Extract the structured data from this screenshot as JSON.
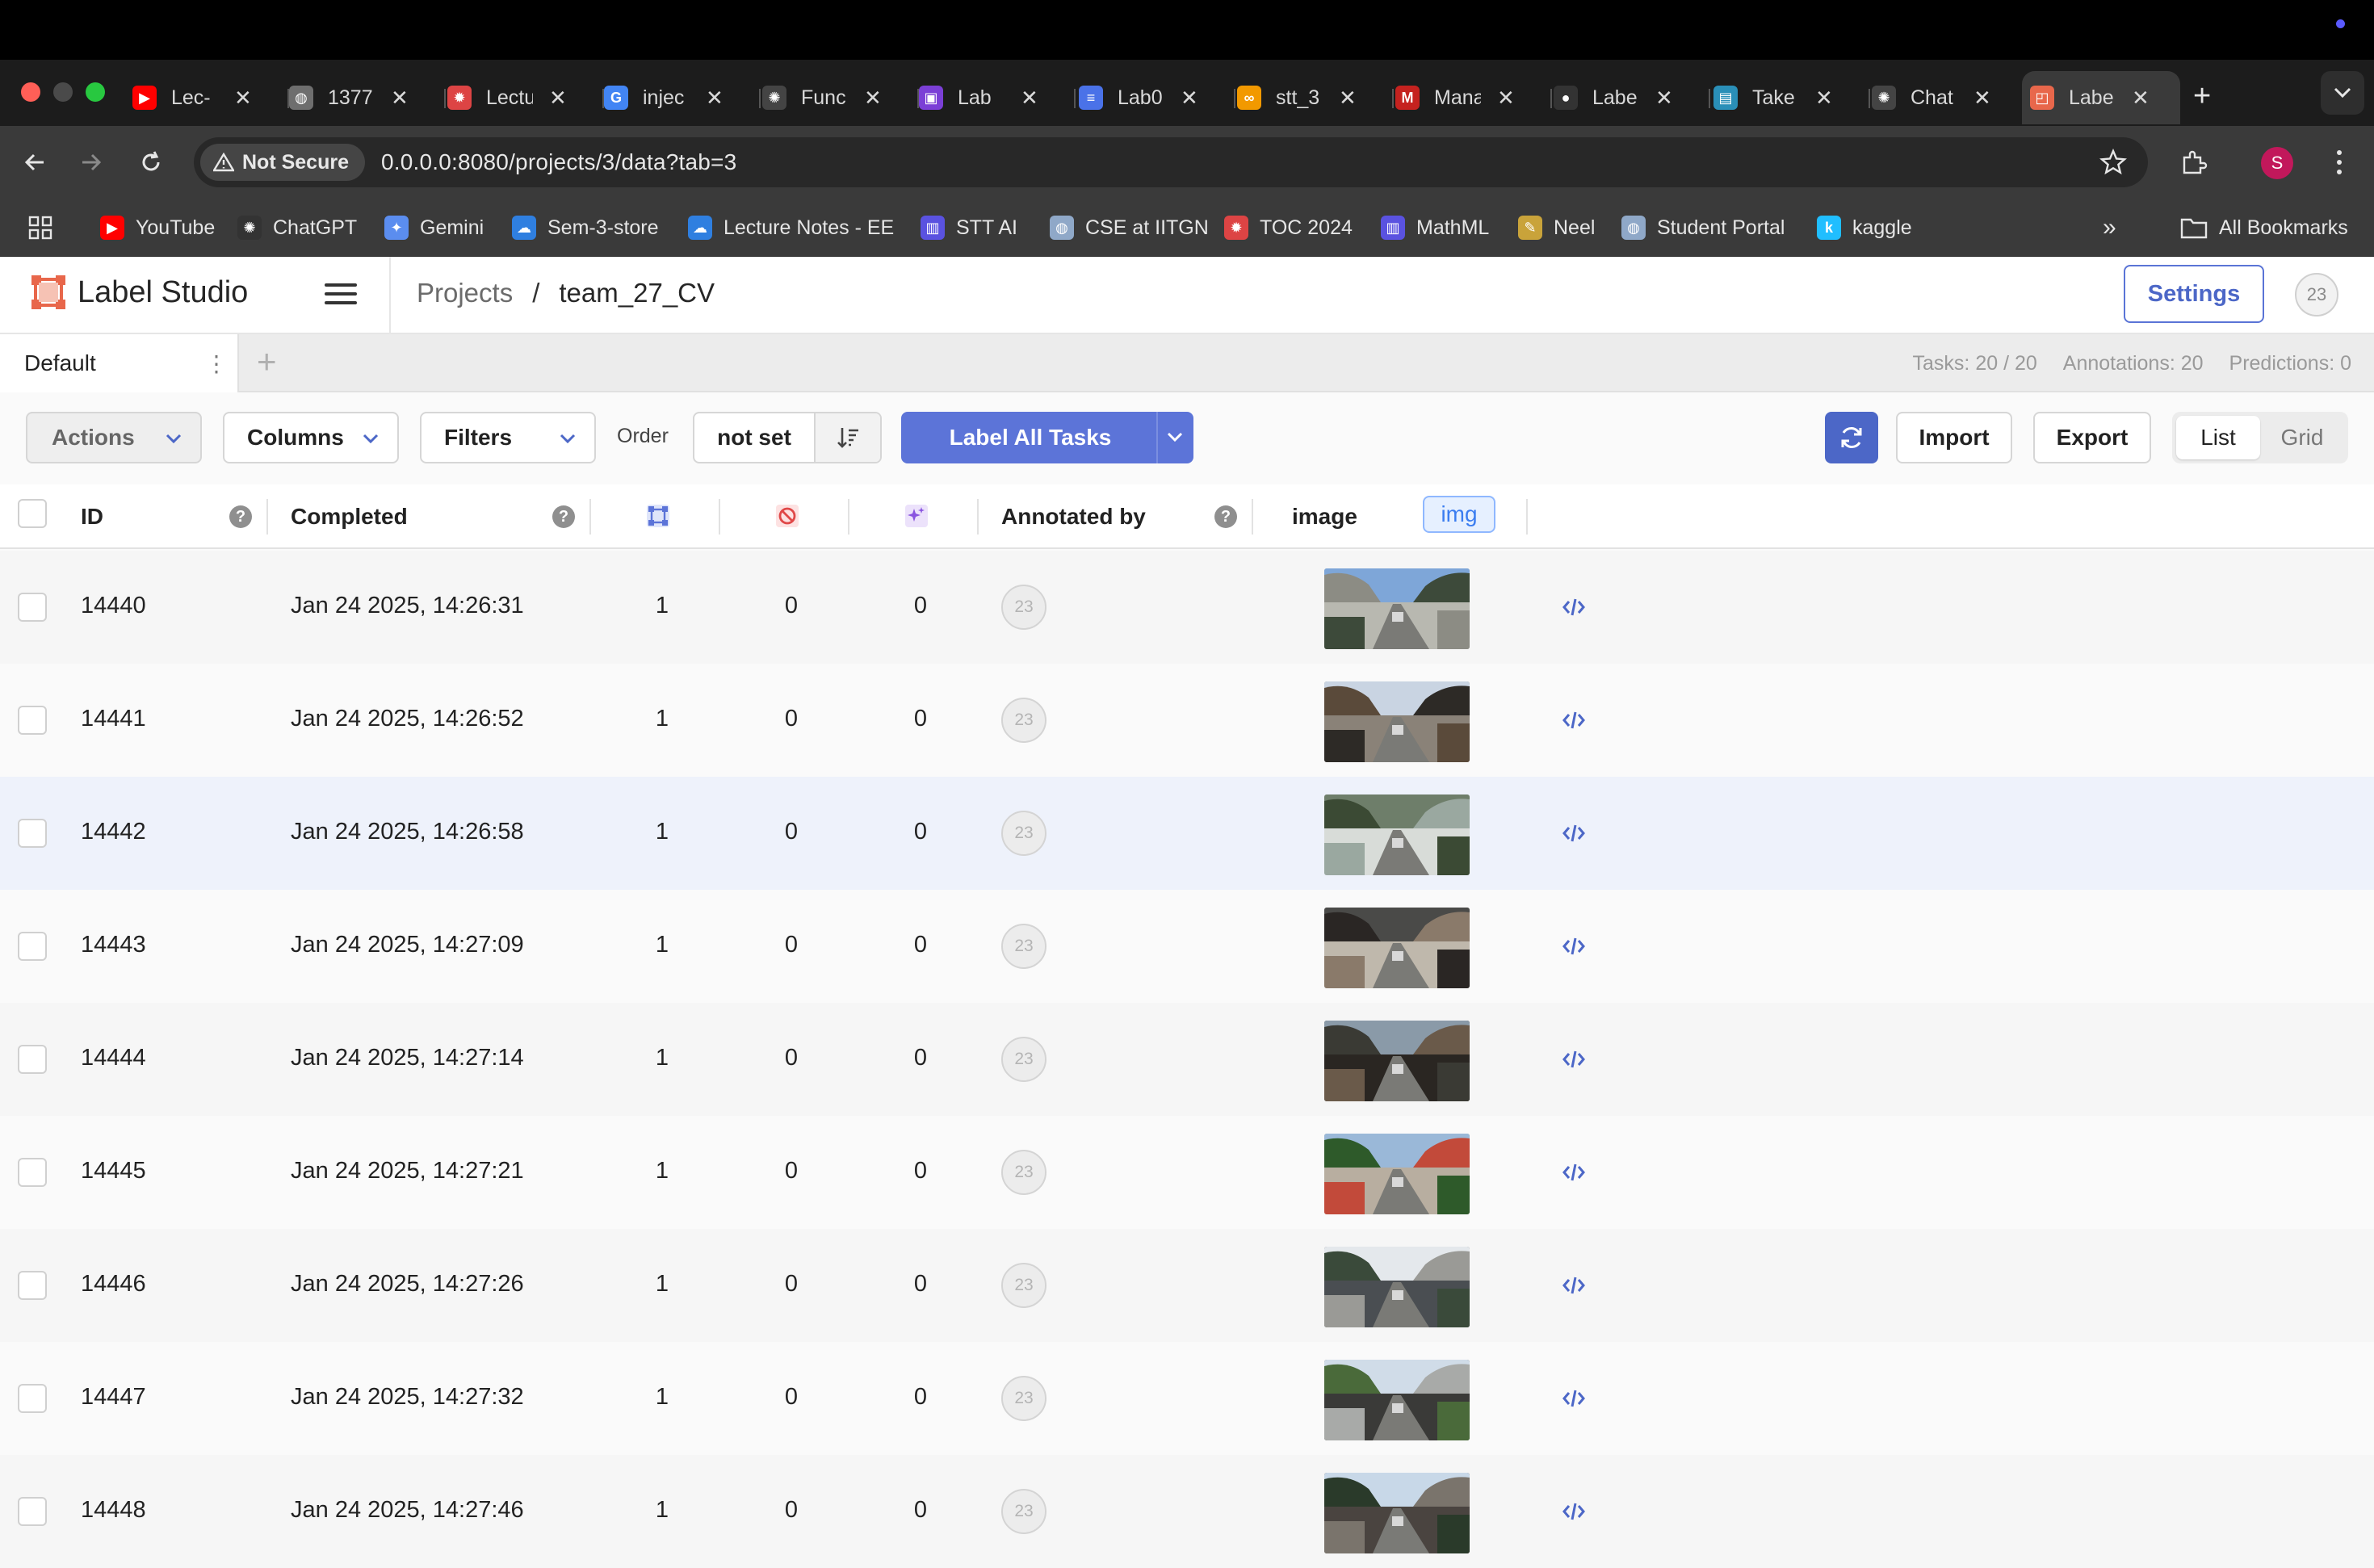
{
  "browser": {
    "tabs": [
      {
        "label": "Lec-",
        "icon": "youtube-icon",
        "color": "#ff0000",
        "glyph": "▶"
      },
      {
        "label": "1377",
        "icon": "globe-icon",
        "color": "#6e6e6e",
        "glyph": "◍"
      },
      {
        "label": "Lectu",
        "icon": "gear-red-icon",
        "color": "#d44",
        "glyph": "✹"
      },
      {
        "label": "injec",
        "icon": "google-icon",
        "color": "#4285f4",
        "glyph": "G"
      },
      {
        "label": "Func",
        "icon": "chatgpt-icon",
        "color": "#444",
        "glyph": "✺"
      },
      {
        "label": "Lab",
        "icon": "classroom-icon",
        "color": "#7b3fd6",
        "glyph": "▣"
      },
      {
        "label": "Lab0",
        "icon": "docs-icon",
        "color": "#4a72e8",
        "glyph": "≡"
      },
      {
        "label": "stt_3",
        "icon": "colab-icon",
        "color": "#f29900",
        "glyph": "∞"
      },
      {
        "label": "Mana",
        "icon": "gmail-icon",
        "color": "#c5221f",
        "glyph": "M"
      },
      {
        "label": "Labe",
        "icon": "github-icon",
        "color": "#333",
        "glyph": "●"
      },
      {
        "label": "Take",
        "icon": "quiz-icon",
        "color": "#2a8fb8",
        "glyph": "▤"
      },
      {
        "label": "Chat",
        "icon": "chatgpt-icon",
        "color": "#444",
        "glyph": "✺"
      },
      {
        "label": "Labe",
        "icon": "label-studio-icon",
        "color": "#e8674b",
        "glyph": "◰"
      }
    ],
    "url_warning": "Not Secure",
    "url": "0.0.0.0:8080/projects/3/data?tab=3",
    "profile_initial": "S",
    "bookmarks": [
      {
        "label": "YouTube",
        "icon": "youtube-icon",
        "color": "#ff0000",
        "glyph": "▶"
      },
      {
        "label": "ChatGPT",
        "icon": "chatgpt-icon",
        "color": "#333",
        "glyph": "✺"
      },
      {
        "label": "Gemini",
        "icon": "gemini-icon",
        "color": "#5b8def",
        "glyph": "✦"
      },
      {
        "label": "Sem-3-store",
        "icon": "onedrive-icon",
        "color": "#2f7fe0",
        "glyph": "☁"
      },
      {
        "label": "Lecture Notes - EE",
        "icon": "onedrive-icon",
        "color": "#2f7fe0",
        "glyph": "☁"
      },
      {
        "label": "STT AI",
        "icon": "forms-icon",
        "color": "#5a52e0",
        "glyph": "▥"
      },
      {
        "label": "CSE at IITGN",
        "icon": "iitgn-icon",
        "color": "#8fa8c8",
        "glyph": "◍"
      },
      {
        "label": "TOC 2024",
        "icon": "gear-red-icon",
        "color": "#d44",
        "glyph": "✹"
      },
      {
        "label": "MathML",
        "icon": "forms-icon",
        "color": "#5a52e0",
        "glyph": "▥"
      },
      {
        "label": "Neel",
        "icon": "feather-icon",
        "color": "#c9a33a",
        "glyph": "✎"
      },
      {
        "label": "Student Portal",
        "icon": "iitgn-icon",
        "color": "#8fa8c8",
        "glyph": "◍"
      },
      {
        "label": "kaggle",
        "icon": "kaggle-icon",
        "color": "#20beff",
        "glyph": "k"
      }
    ],
    "all_bookmarks": "All Bookmarks"
  },
  "app": {
    "name": "Label Studio",
    "breadcrumb": {
      "projects": "Projects",
      "separator": "/",
      "current": "team_27_CV"
    },
    "settings_label": "Settings",
    "user_initials": "23"
  },
  "views": {
    "active_tab": "Default",
    "stats": {
      "tasks": "Tasks: 20 / 20",
      "annotations": "Annotations: 20",
      "predictions": "Predictions: 0"
    }
  },
  "toolbar": {
    "actions": "Actions",
    "columns": "Columns",
    "filters": "Filters",
    "order_label": "Order",
    "order_value": "not set",
    "label_all": "Label All Tasks",
    "import": "Import",
    "export": "Export",
    "view_list": "List",
    "view_grid": "Grid",
    "accent": "#5c74d8"
  },
  "table": {
    "headers": {
      "id": "ID",
      "completed": "Completed",
      "annotated_by": "Annotated by",
      "image": "image",
      "image_chip": "img"
    },
    "rows": [
      {
        "id": "14440",
        "completed": "Jan 24 2025, 14:26:31",
        "annotations": "1",
        "cancelled": "0",
        "predictions": "0",
        "annotator": "23"
      },
      {
        "id": "14441",
        "completed": "Jan 24 2025, 14:26:52",
        "annotations": "1",
        "cancelled": "0",
        "predictions": "0",
        "annotator": "23"
      },
      {
        "id": "14442",
        "completed": "Jan 24 2025, 14:26:58",
        "annotations": "1",
        "cancelled": "0",
        "predictions": "0",
        "annotator": "23"
      },
      {
        "id": "14443",
        "completed": "Jan 24 2025, 14:27:09",
        "annotations": "1",
        "cancelled": "0",
        "predictions": "0",
        "annotator": "23"
      },
      {
        "id": "14444",
        "completed": "Jan 24 2025, 14:27:14",
        "annotations": "1",
        "cancelled": "0",
        "predictions": "0",
        "annotator": "23"
      },
      {
        "id": "14445",
        "completed": "Jan 24 2025, 14:27:21",
        "annotations": "1",
        "cancelled": "0",
        "predictions": "0",
        "annotator": "23"
      },
      {
        "id": "14446",
        "completed": "Jan 24 2025, 14:27:26",
        "annotations": "1",
        "cancelled": "0",
        "predictions": "0",
        "annotator": "23"
      },
      {
        "id": "14447",
        "completed": "Jan 24 2025, 14:27:32",
        "annotations": "1",
        "cancelled": "0",
        "predictions": "0",
        "annotator": "23"
      },
      {
        "id": "14448",
        "completed": "Jan 24 2025, 14:27:46",
        "annotations": "1",
        "cancelled": "0",
        "predictions": "0",
        "annotator": "23"
      }
    ]
  }
}
